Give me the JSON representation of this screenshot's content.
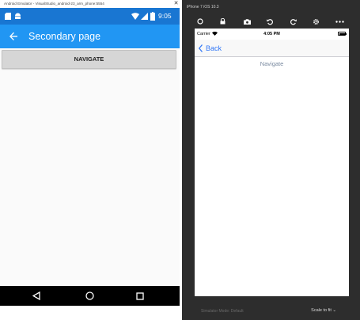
{
  "android": {
    "window_title": "Android Emulator - VisualStudio_android-23_arm_phone:5554",
    "status_time": "9:05",
    "page_title": "Secondary page",
    "button_label": "NAVIGATE"
  },
  "ios": {
    "window_title": "iPhone 7 iOS 10.3",
    "carrier": "Carrier",
    "time": "4:05 PM",
    "back_label": "Back",
    "navigate_link": "Navigate",
    "bottom_status": "Simulator Mode: Default",
    "scale_label": "Scale to fit"
  },
  "colors": {
    "android_appbar": "#2196f3",
    "android_statusbar": "#1976d2",
    "ios_accent": "#3478f6",
    "ios_chrome": "#2d2d2d"
  }
}
